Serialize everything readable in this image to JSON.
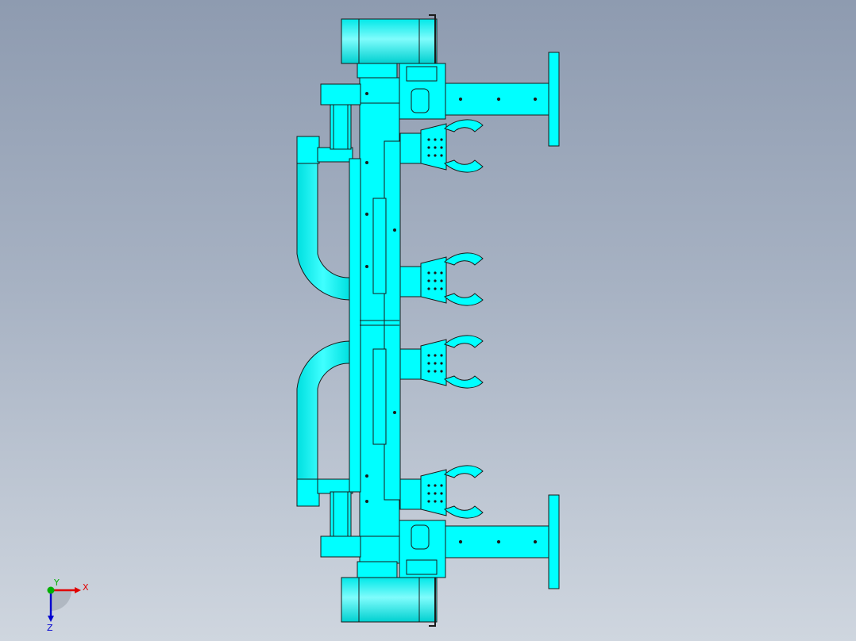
{
  "viewport": {
    "colors": {
      "background_top": "#8e9bb0",
      "background_bottom": "#cfd6df",
      "part_fill": "#00ffff",
      "part_edge": "#1a1a1a",
      "x_axis": "#e00000",
      "y_axis": "#00b000",
      "z_axis": "#0000d0"
    }
  },
  "model": {
    "name": "gripper-assembly",
    "view": "top",
    "gripper_count": 4,
    "wheel_count": 2,
    "cable_chain_count": 2,
    "mounting_arm_count": 2
  },
  "triad": {
    "x_label": "X",
    "y_label": "Y",
    "z_label": "Z"
  }
}
